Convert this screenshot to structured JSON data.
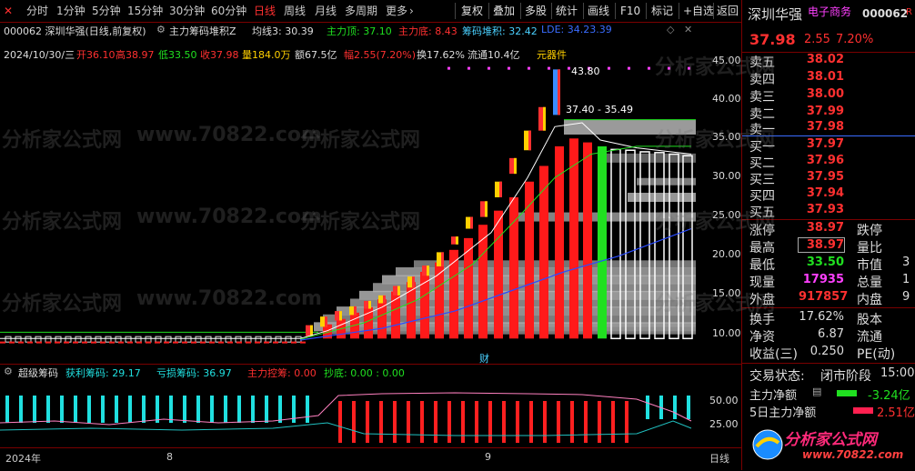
{
  "toolbar": {
    "left_tabs": [
      "分时",
      "1分钟",
      "5分钟",
      "15分钟",
      "30分钟",
      "60分钟",
      "日线",
      "周线",
      "月线",
      "多周期",
      "更多"
    ],
    "active_tab": "日线",
    "more_arrow": "›",
    "right_buttons": [
      "复权",
      "叠加",
      "多股",
      "统计",
      "画线",
      "F10",
      "标记",
      "+自选",
      "返回"
    ]
  },
  "info_line": {
    "code_name": "000062 深圳华强(日线,前复权)",
    "indicator_name": "主力筹码堆积Z",
    "ma3": "均线3: 30.39",
    "peak": "主力顶: 37.10",
    "bottom": "主力底: 8.43",
    "chip": "筹码堆积: 32.42",
    "extra": "LDE: 34.23.39"
  },
  "ohlc": {
    "date": "2024/10/30/三",
    "open": "开36.10",
    "high": "高38.97",
    "low": "低33.50",
    "close": "收37.98",
    "volume": "量184.0万",
    "amount": "额67.5亿",
    "change": "幅2.55(7.20%)",
    "turnover": "换17.62%",
    "float": "流通10.4亿",
    "sector": "元器件"
  },
  "annotations": {
    "high_price": "43.80",
    "range": "37.40 - 35.49",
    "fin_marker": "财"
  },
  "y_axis": [
    "45.00",
    "40.00",
    "35.00",
    "30.00",
    "25.00",
    "20.00",
    "15.00",
    "10.00"
  ],
  "indicator_header": {
    "name": "超级筹码",
    "profit": "获利筹码: 29.17",
    "loss": "亏损筹码: 36.97",
    "control": "主力控筹: 0.00",
    "bottom": "抄底: 0.00 : 0.00"
  },
  "ind_y_axis": [
    "50.00",
    "25.00"
  ],
  "time_axis": {
    "year": "2024年",
    "m8": "8",
    "m9": "9",
    "right": "日线"
  },
  "panel": {
    "stock_name": "深圳华强",
    "sector_tag": "电子商务",
    "code": "000062",
    "code_suffix": "R",
    "price": "37.98",
    "change": "2.55",
    "change_pct": "7.20%",
    "asks": [
      {
        "label": "卖五",
        "price": "38.02"
      },
      {
        "label": "卖四",
        "price": "38.01"
      },
      {
        "label": "卖三",
        "price": "38.00"
      },
      {
        "label": "卖二",
        "price": "37.99"
      },
      {
        "label": "卖一",
        "price": "37.98"
      }
    ],
    "bids": [
      {
        "label": "买一",
        "price": "37.97"
      },
      {
        "label": "买二",
        "price": "37.96"
      },
      {
        "label": "买三",
        "price": "37.95"
      },
      {
        "label": "买四",
        "price": "37.94"
      },
      {
        "label": "买五",
        "price": "37.93"
      }
    ],
    "stats": [
      {
        "l1": "涨停",
        "v1": "38.97",
        "l2": "跌停",
        "v2": ""
      },
      {
        "l1": "最高",
        "v1": "38.97",
        "l2": "量比",
        "v2": ""
      },
      {
        "l1": "最低",
        "v1": "33.50",
        "l2": "市值",
        "v2": "3"
      },
      {
        "l1": "现量",
        "v1": "17935",
        "l2": "总量",
        "v2": "1"
      },
      {
        "l1": "外盘",
        "v1": "917857",
        "l2": "内盘",
        "v2": "9"
      }
    ],
    "stats2": [
      {
        "l1": "换手",
        "v1": "17.62%",
        "l2": "股本",
        "v2": ""
      },
      {
        "l1": "净资",
        "v1": "6.87",
        "l2": "流通",
        "v2": ""
      },
      {
        "l1": "收益(三)",
        "v1": "0.250",
        "l2": "PE(动)",
        "v2": ""
      }
    ],
    "trade_state_label": "交易状态:",
    "trade_state": "闭市阶段",
    "trade_time": "15:00",
    "net1_label": "主力净额",
    "net1_val": "-3.24亿",
    "net2_label": "5日主力净额",
    "net2_val": "2.51亿",
    "brand": "分析家公式网",
    "brand_url": "www.70822.com"
  },
  "watermarks": [
    "分析家公式网",
    "www.70822.com"
  ],
  "colors": {
    "up": "#ff2020",
    "down": "#20e020",
    "bg": "#000000",
    "frame": "#7a0000",
    "accent_blue": "#3a6cff",
    "magenta": "#ff40ff",
    "cyan": "#20e0e0"
  }
}
